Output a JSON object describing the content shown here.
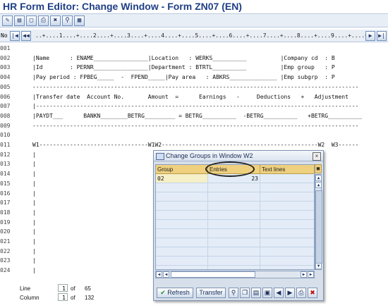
{
  "window": {
    "title": "HR Form Editor: Change Window - Form ZN07 (EN)"
  },
  "toolbar_icons": [
    "pencil-glasses-icon",
    "form-icon",
    "window-icon",
    "print-icon",
    "delete-icon",
    "search-icon",
    "table-icon"
  ],
  "ruler": {
    "line_no": "No",
    "text": "..+....1....+....2....+....3....+....4....+....5....+....6....+....7....+....8....+....9....+....0"
  },
  "editor_lines": [
    {
      "no": "001",
      "text": ""
    },
    {
      "no": "002",
      "text": "|Name      : ENAME________________|Location   : WERKS__________          |Company cd  : B"
    },
    {
      "no": "003",
      "text": "|Id        : PERNR________________|Department : BTRTL__________          |Emp group   : P"
    },
    {
      "no": "004",
      "text": "|Pay period : FPBEG_____  -  FPEND_____|Pay area   : ABKRS______________ |Emp subgrp  : P"
    },
    {
      "no": "005",
      "text": "------------------------------------------------------------------------------------------------"
    },
    {
      "no": "006",
      "text": "|Transfer date  Account No.       Amount  =      Earnings   -     Deductions   +   Adjustment"
    },
    {
      "no": "007",
      "text": "|-----------------------------------------------------------------------------------------------"
    },
    {
      "no": "008",
      "text": "|PAYDT___      BANKN________BETRG_________ = BETRG__________  -BETRG__________   +BETRG__________"
    },
    {
      "no": "009",
      "text": "------------------------------------------------------------------------------------------------"
    },
    {
      "no": "010",
      "text": ""
    },
    {
      "no": "011",
      "text": "W1--------------------------------W1W2----------------------------------------------W2  W3------"
    },
    {
      "no": "012",
      "text": "|"
    },
    {
      "no": "013",
      "text": "|"
    },
    {
      "no": "014",
      "text": "|"
    },
    {
      "no": "015",
      "text": "|"
    },
    {
      "no": "016",
      "text": "|"
    },
    {
      "no": "017",
      "text": "|"
    },
    {
      "no": "018",
      "text": "|"
    },
    {
      "no": "019",
      "text": "|"
    },
    {
      "no": "020",
      "text": "|"
    },
    {
      "no": "021",
      "text": "|"
    },
    {
      "no": "022",
      "text": "|"
    },
    {
      "no": "023",
      "text": "|"
    },
    {
      "no": "024",
      "text": "|"
    }
  ],
  "status": {
    "line_label": "Line",
    "line_value": "1",
    "line_of": "of",
    "line_total": "65",
    "column_label": "Column",
    "column_value": "1",
    "column_of": "of",
    "column_total": "132"
  },
  "dialog": {
    "title": "Change Groups in Window W2",
    "columns": [
      "Group",
      "Entries",
      "Text lines"
    ],
    "rows": [
      {
        "group": "02",
        "entries": "23",
        "text_lines": ""
      }
    ],
    "buttons": {
      "refresh": "Refresh",
      "transfer": "Transfer"
    },
    "icon_buttons": [
      "search-icon",
      "copy-icon",
      "paste-icon",
      "save-icon",
      "prev-icon",
      "next-icon",
      "print-icon",
      "cancel-icon"
    ]
  }
}
